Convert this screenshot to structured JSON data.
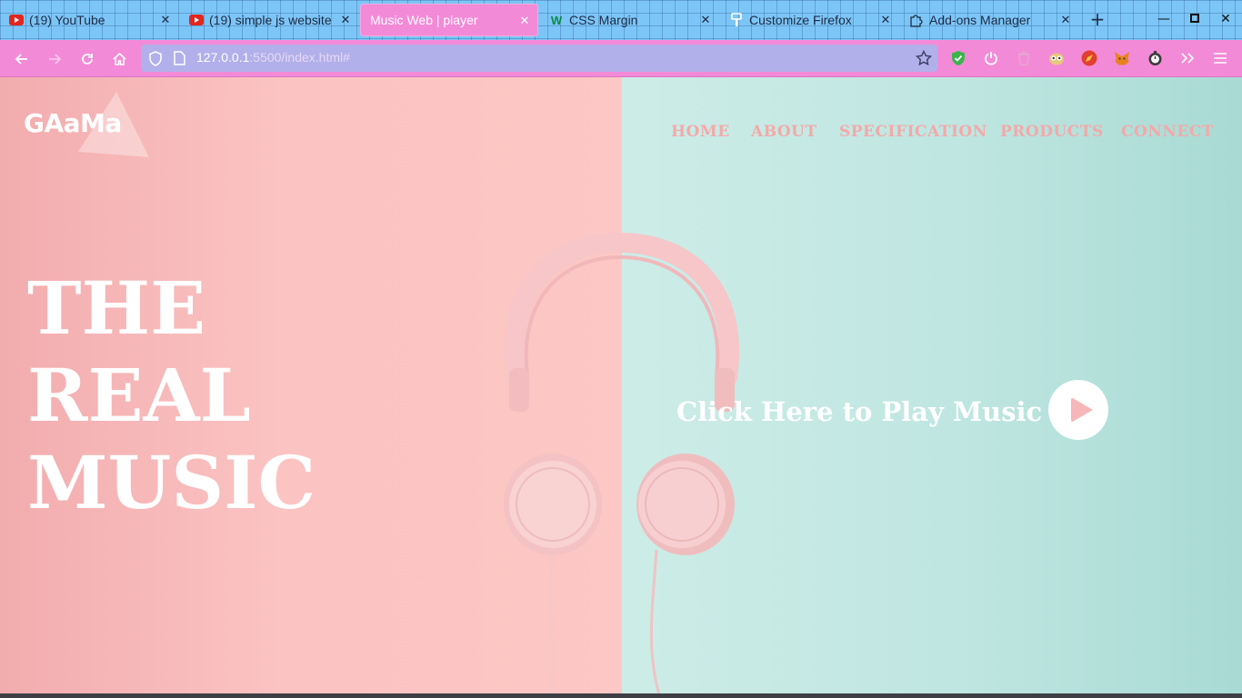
{
  "browser": {
    "tabs": [
      {
        "title": "(19) YouTube",
        "icon": "youtube-icon",
        "active": false
      },
      {
        "title": "(19) simple js website",
        "icon": "youtube-icon",
        "active": false
      },
      {
        "title": "Music Web | player",
        "icon": "",
        "active": true
      },
      {
        "title": "CSS Margin",
        "icon": "w3schools-icon",
        "active": false
      },
      {
        "title": "Customize Firefox",
        "icon": "brush-icon",
        "active": false
      },
      {
        "title": "Add-ons Manager",
        "icon": "puzzle-icon",
        "active": false
      }
    ],
    "url": {
      "host": "127.0.0.1",
      "path": ":5500/index.html#"
    },
    "colors": {
      "tab_strip": "#7cc6f7",
      "toolbar": "#f38ad7",
      "active_tab": "#f38ad7",
      "url_bar": "#b1b0ea"
    }
  },
  "site": {
    "logo": "GAaMa",
    "nav": [
      "HOME",
      "ABOUT",
      "SPECIFICATION",
      "PRODUCTS",
      "CONNECT"
    ],
    "hero_lines": [
      "THE",
      "REAL",
      "MUSIC"
    ],
    "play_label": "Click Here to Play Music",
    "colors": {
      "left_bg": "#fbc3c2",
      "right_bg": "#bfe6e1",
      "nav_text": "#f3a9a9",
      "play_icon": "#f7b6b7"
    }
  }
}
